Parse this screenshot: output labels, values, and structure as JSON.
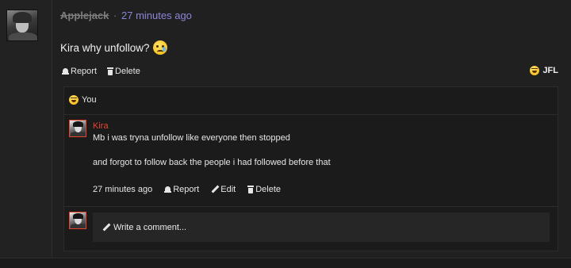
{
  "post": {
    "author": "Applejack",
    "separator": "·",
    "time": "27 minutes ago",
    "text": "Kira why unfollow?",
    "text_emoji": "crying-face-emoji",
    "actions": {
      "report": "Report",
      "delete": "Delete"
    },
    "reaction": {
      "emoji": "laughing-emoji",
      "label": "JFL"
    }
  },
  "comments_section": {
    "likes": {
      "emoji": "laughing-emoji",
      "label": "You"
    },
    "comment": {
      "author": "Kira",
      "line1": "Mb i was tryna unfollow like everyone then stopped",
      "line2": "and forgot to follow back the people i had followed before that",
      "time": "27 minutes ago",
      "report": "Report",
      "edit": "Edit",
      "delete": "Delete"
    },
    "write": {
      "placeholder": "Write a comment..."
    }
  },
  "colors": {
    "background": "#1f1f1f",
    "time_link": "#8a86d8",
    "comment_author": "#e8442b",
    "author_strike": "#7d7d7d"
  }
}
